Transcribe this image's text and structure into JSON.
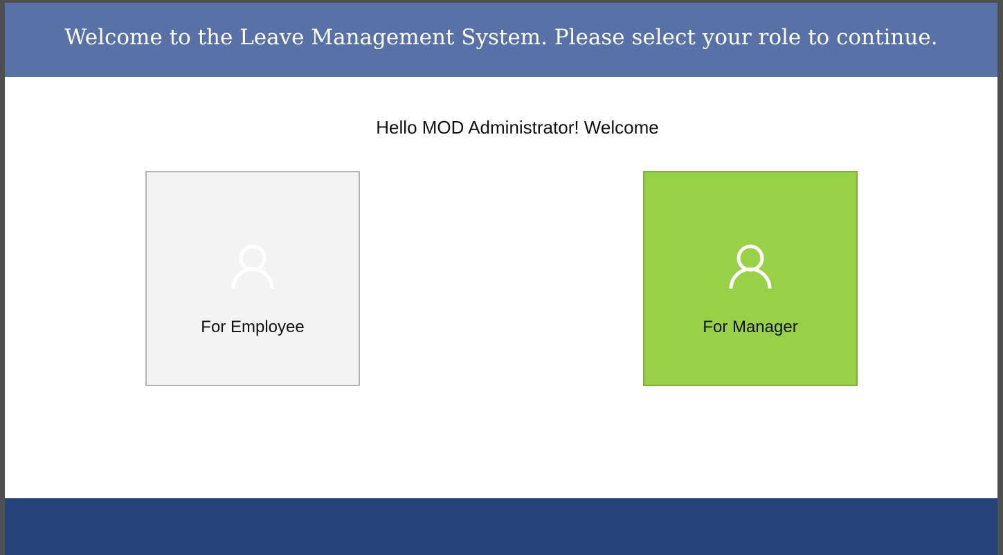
{
  "header": {
    "title": "Welcome to the Leave Management System. Please select your role to continue."
  },
  "greeting": {
    "text": "Hello MOD Administrator! Welcome"
  },
  "roles": [
    {
      "label": "For Employee",
      "icon": "user-icon",
      "color": "#f3f3f3"
    },
    {
      "label": "For Manager",
      "icon": "user-icon",
      "color": "#99d146"
    }
  ],
  "colors": {
    "header_bg": "#5872a8",
    "footer_bg": "#25427a"
  }
}
